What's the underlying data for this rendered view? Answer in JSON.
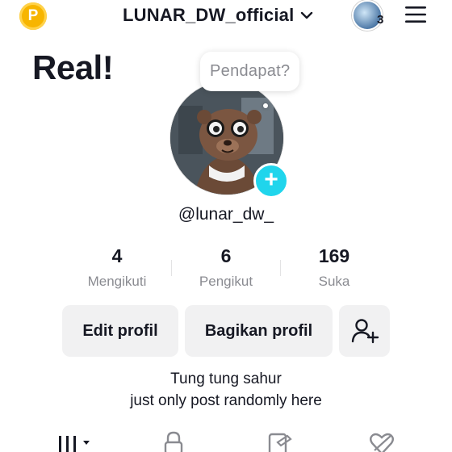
{
  "header": {
    "coin_letter": "P",
    "username": "LUNAR_DW_official",
    "story_count": "3"
  },
  "banner_text": "Real!",
  "bubble_text": "Pendapat?",
  "handle": "@lunar_dw_",
  "stats": [
    {
      "value": "4",
      "label": "Mengikuti"
    },
    {
      "value": "6",
      "label": "Pengikut"
    },
    {
      "value": "169",
      "label": "Suka"
    }
  ],
  "buttons": {
    "edit": "Edit profil",
    "share": "Bagikan profil"
  },
  "bio": {
    "line1": "Tung tung sahur",
    "line2": "just only post randomly here"
  },
  "colors": {
    "accent_cyan": "#20d5ec",
    "coin": "#f7b500",
    "button_bg": "#f1f1f2",
    "muted_text": "#8a8b91"
  },
  "icons": [
    "coin-icon",
    "chevron-down-icon",
    "menu-icon",
    "plus-icon",
    "add-friend-icon",
    "grid-icon",
    "lock-icon",
    "repost-icon",
    "liked-icon"
  ]
}
